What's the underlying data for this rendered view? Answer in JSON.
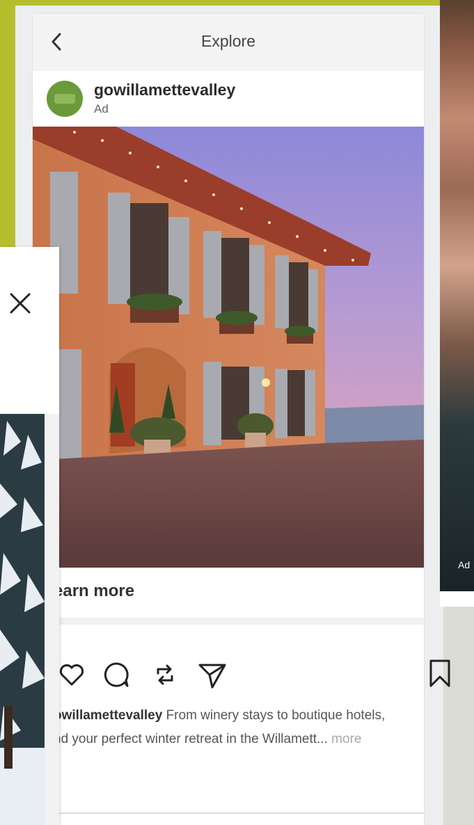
{
  "header": {
    "title": "Explore"
  },
  "post": {
    "username": "gowillamettevalley",
    "ad_label": "Ad",
    "cta": "earn more",
    "caption_user": "owillamettevalley",
    "caption_line1": "From winery stays to boutique hotels,",
    "caption_line2": "nd your perfect winter retreat in the Willamett...",
    "more_label": "more"
  },
  "right_panel": {
    "ad_label": "Ad"
  },
  "icons": [
    "chevron-left-icon",
    "heart-icon",
    "comment-icon",
    "repost-icon",
    "share-icon",
    "bookmark-icon",
    "close-icon"
  ],
  "colors": {
    "lime": "#b6be2e",
    "avatar": "#6a9a3a"
  }
}
